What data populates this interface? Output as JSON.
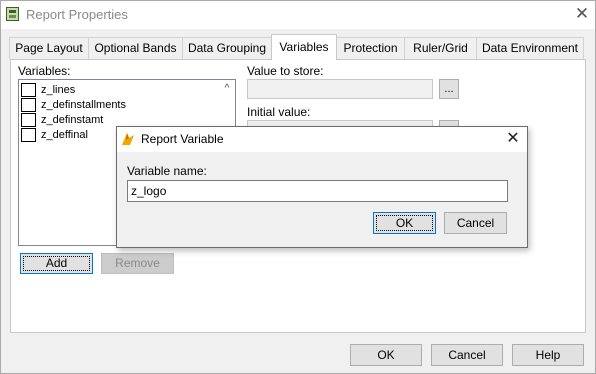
{
  "window": {
    "title": "Report Properties",
    "close_glyph": "✕"
  },
  "tabs": [
    {
      "label": "Page Layout"
    },
    {
      "label": "Optional Bands"
    },
    {
      "label": "Data Grouping"
    },
    {
      "label": "Variables",
      "active": true
    },
    {
      "label": "Protection"
    },
    {
      "label": "Ruler/Grid"
    },
    {
      "label": "Data Environment"
    }
  ],
  "variables": {
    "label": "Variables:",
    "items": [
      {
        "name": "z_lines"
      },
      {
        "name": "z_definstallments"
      },
      {
        "name": "z_definstamt"
      },
      {
        "name": "z_deffinal"
      }
    ],
    "scroll_up_glyph": "^",
    "add_label": "Add",
    "remove_label": "Remove"
  },
  "value_to_store": {
    "label": "Value to store:",
    "value": "",
    "button": "..."
  },
  "initial_value": {
    "label": "Initial value:",
    "button": "..."
  },
  "footer": {
    "ok": "OK",
    "cancel": "Cancel",
    "help": "Help"
  },
  "dialog": {
    "title": "Report Variable",
    "close_glyph": "✕",
    "field_label": "Variable name:",
    "field_value": "z_logo",
    "ok": "OK",
    "cancel": "Cancel"
  },
  "colors": {
    "accent": "#0078d7",
    "panel_bg": "#f0f0f0",
    "dialog_icon": "#f2a600"
  }
}
